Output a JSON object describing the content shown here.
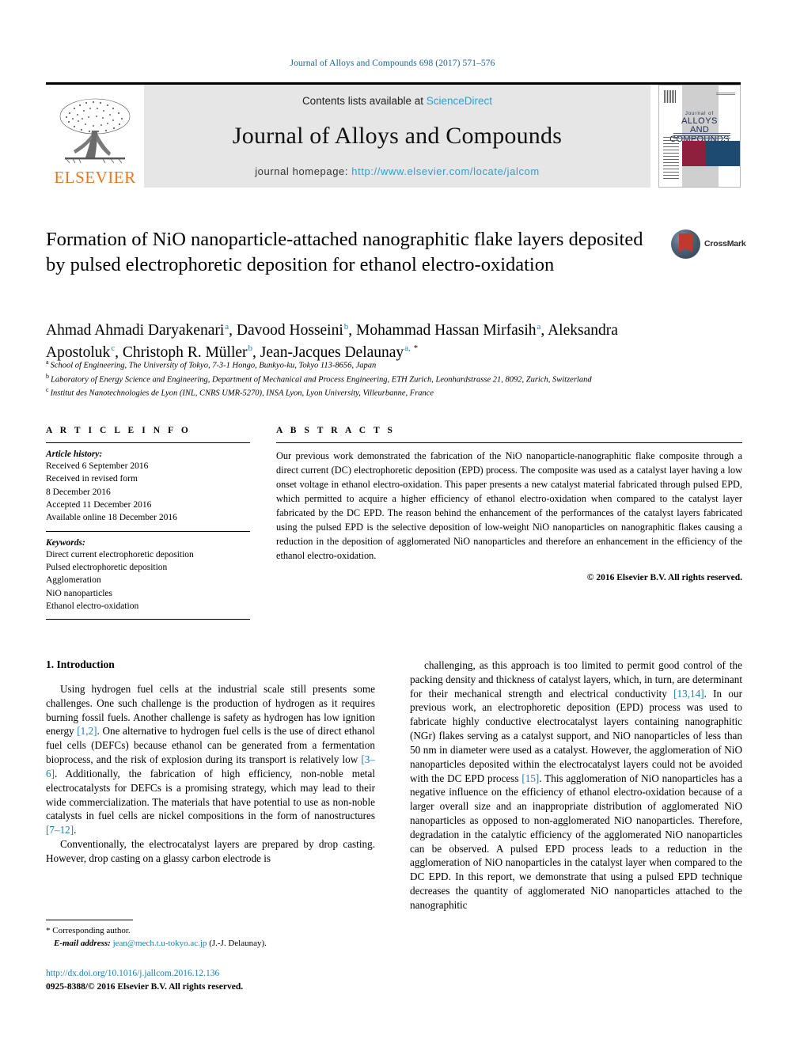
{
  "running_head": "Journal of Alloys and Compounds 698 (2017) 571–576",
  "banner": {
    "contents_prefix": "Contents lists available at ",
    "sciencedirect": "ScienceDirect",
    "journal_name": "Journal of Alloys and Compounds",
    "homepage_label": "journal homepage: ",
    "homepage_url": "http://www.elsevier.com/locate/jalcom",
    "publisher": "ELSEVIER",
    "cover": {
      "line1": "Journal of",
      "line2": "ALLOYS",
      "line3": "AND COMPOUNDS"
    },
    "link_color": "#2f9fd0",
    "band_color": "#e6e6e6"
  },
  "crossmark": {
    "label": "CrossMark"
  },
  "title": "Formation of NiO nanoparticle-attached nanographitic flake layers deposited by pulsed electrophoretic deposition for ethanol electro-oxidation",
  "authors": [
    {
      "name": "Ahmad Ahmadi Daryakenari",
      "marks": "a"
    },
    {
      "name": "Davood Hosseini",
      "marks": "b"
    },
    {
      "name": "Mohammad Hassan Mirfasih",
      "marks": "a"
    },
    {
      "name": "Aleksandra Apostoluk",
      "marks": "c"
    },
    {
      "name": "Christoph R. Müller",
      "marks": "b"
    },
    {
      "name": "Jean-Jacques Delaunay",
      "marks": "a",
      "corresponding": true
    }
  ],
  "affiliations": [
    {
      "mark": "a",
      "text": "School of Engineering, The University of Tokyo, 7-3-1 Hongo, Bunkyo-ku, Tokyo 113-8656, Japan"
    },
    {
      "mark": "b",
      "text": "Laboratory of Energy Science and Engineering, Department of Mechanical and Process Engineering, ETH Zurich, Leonhardstrasse 21, 8092, Zurich, Switzerland"
    },
    {
      "mark": "c",
      "text": "Institut des Nanotechnologies de Lyon (INL, CNRS UMR-5270), INSA Lyon, Lyon University, Villeurbanne, France"
    }
  ],
  "article_info": {
    "heading": "A R T I C L E   I N F O",
    "history_label": "Article history:",
    "history": [
      "Received 6 September 2016",
      "Received in revised form",
      "8 December 2016",
      "Accepted 11 December 2016",
      "Available online 18 December 2016"
    ],
    "keywords_label": "Keywords:",
    "keywords": [
      "Direct current electrophoretic deposition",
      "Pulsed electrophoretic deposition",
      "Agglomeration",
      "NiO nanoparticles",
      "Ethanol electro-oxidation"
    ]
  },
  "abstract": {
    "heading": "A B S T R A C T S",
    "text": "Our previous work demonstrated the fabrication of the NiO nanoparticle-nanographitic flake composite through a direct current (DC) electrophoretic deposition (EPD) process. The composite was used as a catalyst layer having a low onset voltage in ethanol electro-oxidation. This paper presents a new catalyst material fabricated through pulsed EPD, which permitted to acquire a higher efficiency of ethanol electro-oxidation when compared to the catalyst layer fabricated by the DC EPD. The reason behind the enhancement of the performances of the catalyst layers fabricated using the pulsed EPD is the selective deposition of low-weight NiO nanoparticles on nanographitic flakes causing a reduction in the deposition of agglomerated NiO nanoparticles and therefore an enhancement in the efficiency of the ethanol electro-oxidation.",
    "copyright": "© 2016 Elsevier B.V. All rights reserved."
  },
  "introduction": {
    "section_number": "1.",
    "section_title": "Introduction",
    "left_paragraphs": [
      "Using hydrogen fuel cells at the industrial scale still presents some challenges. One such challenge is the production of hydrogen as it requires burning fossil fuels. Another challenge is safety as hydrogen has low ignition energy [1,2]. One alternative to hydrogen fuel cells is the use of direct ethanol fuel cells (DEFCs) because ethanol can be generated from a fermentation bioprocess, and the risk of explosion during its transport is relatively low [3–6]. Additionally, the fabrication of high efficiency, non-noble metal electrocatalysts for DEFCs is a promising strategy, which may lead to their wide commercialization. The materials that have potential to use as non-noble catalysts in fuel cells are nickel compositions in the form of nanostructures [7–12].",
      "Conventionally, the electrocatalyst layers are prepared by drop casting. However, drop casting on a glassy carbon electrode is"
    ],
    "right_paragraphs": [
      "challenging, as this approach is too limited to permit good control of the packing density and thickness of catalyst layers, which, in turn, are determinant for their mechanical strength and electrical conductivity [13,14]. In our previous work, an electrophoretic deposition (EPD) process was used to fabricate highly conductive electrocatalyst layers containing nanographitic (NGr) flakes serving as a catalyst support, and NiO nanoparticles of less than 50 nm in diameter were used as a catalyst. However, the agglomeration of NiO nanoparticles deposited within the electrocatalyst layers could not be avoided with the DC EPD process [15]. This agglomeration of NiO nanoparticles has a negative influence on the efficiency of ethanol electro-oxidation because of a larger overall size and an inappropriate distribution of agglomerated NiO nanoparticles as opposed to non-agglomerated NiO nanoparticles. Therefore, degradation in the catalytic efficiency of the agglomerated NiO nanoparticles can be observed. A pulsed EPD process leads to a reduction in the agglomeration of NiO nanoparticles in the catalyst layer when compared to the DC EPD. In this report, we demonstrate that using a pulsed EPD technique decreases the quantity of agglomerated NiO nanoparticles attached to the nanographitic"
    ]
  },
  "footer": {
    "corresponding_star": "*",
    "corresponding_label": "Corresponding author.",
    "email_label": "E-mail address:",
    "email": "jean@mech.t.u-tokyo.ac.jp",
    "email_owner": "(J.-J. Delaunay).",
    "doi": "http://dx.doi.org/10.1016/j.jallcom.2016.12.136",
    "issn_line": "0925-8388/© 2016 Elsevier B.V. All rights reserved."
  }
}
